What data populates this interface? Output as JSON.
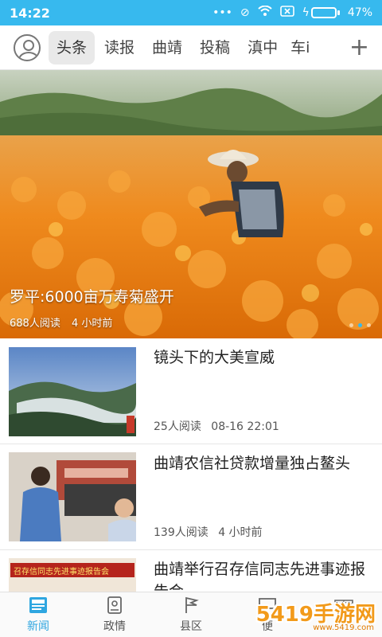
{
  "status": {
    "time": "14:22",
    "battery": "47%",
    "battery_level": 0.47
  },
  "tabs": [
    "头条",
    "读报",
    "曲靖",
    "投稿",
    "滇中",
    "车i"
  ],
  "hero": {
    "title": "罗平:6000亩万寿菊盛开",
    "reads": "688人阅读",
    "time": "4 小时前"
  },
  "news": [
    {
      "title": "镜头下的大美宣威",
      "reads": "25人阅读",
      "time": "08-16 22:01"
    },
    {
      "title": "曲靖农信社贷款增量独占鳌头",
      "reads": "139人阅读",
      "time": "4 小时前"
    },
    {
      "title": "曲靖举行召存信同志先进事迹报告会",
      "reads": "",
      "time": ""
    }
  ],
  "thumb3_banner": "召存信同志先进事迹报告会",
  "bottom_nav": [
    {
      "label": "新闻",
      "icon": "news-icon",
      "active": true
    },
    {
      "label": "政情",
      "icon": "document-icon",
      "active": false
    },
    {
      "label": "县区",
      "icon": "flag-icon",
      "active": false
    },
    {
      "label": "便",
      "icon": "chat-icon",
      "active": false
    },
    {
      "label": "",
      "icon": "gift-icon",
      "active": false
    }
  ],
  "watermark": {
    "text": "5419手游网",
    "url": "www.5419.com"
  },
  "colors": {
    "accent": "#37b9ee",
    "battery": "#9bff3a",
    "active_tab": "#2fa6e0"
  }
}
